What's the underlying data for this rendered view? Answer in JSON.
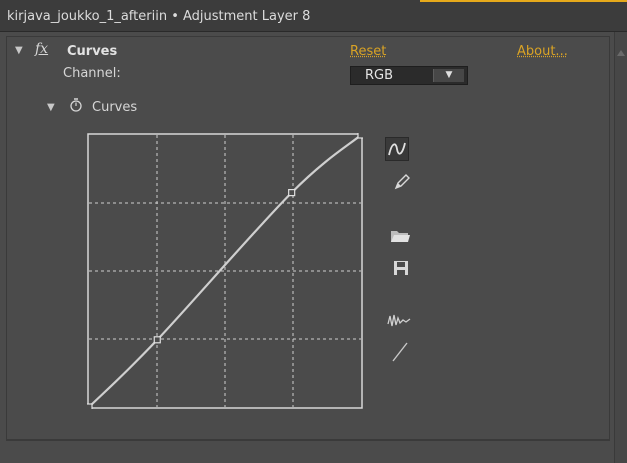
{
  "header": {
    "title": "kirjava_joukko_1_afteriin • Adjustment Layer 8"
  },
  "effect": {
    "fx_label": "fx",
    "name": "Curves",
    "reset_label": "Reset",
    "about_label": "About...",
    "channel_label": "Channel:",
    "channel_value": "RGB",
    "param_label": "Curves"
  },
  "curve": {
    "control_points": [
      [
        0,
        0
      ],
      [
        64,
        63
      ],
      [
        190,
        201
      ],
      [
        255,
        255
      ]
    ],
    "range": [
      0,
      255
    ]
  },
  "tools": [
    {
      "name": "bezier-curve-tool-icon",
      "selected": true
    },
    {
      "name": "pencil-tool-icon",
      "selected": false
    },
    {
      "name": "open-folder-icon",
      "selected": false
    },
    {
      "name": "save-disk-icon",
      "selected": false
    },
    {
      "name": "smooth-curve-icon",
      "selected": false
    },
    {
      "name": "reset-linear-icon",
      "selected": false
    }
  ],
  "colors": {
    "accent": "#d9a325",
    "background": "#4b4b4b",
    "curve": "#cfcfcf"
  }
}
